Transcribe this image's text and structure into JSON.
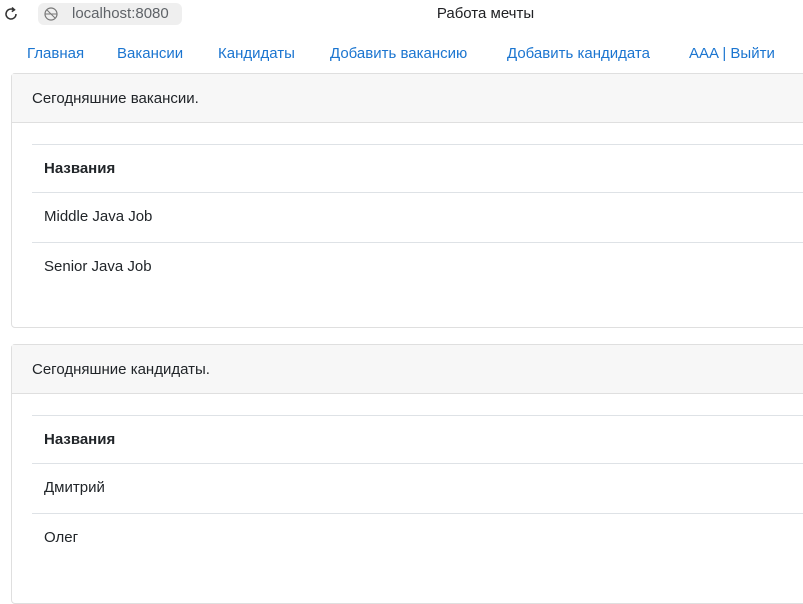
{
  "browser": {
    "address": "localhost:8080",
    "title": "Работа мечты"
  },
  "nav": {
    "items": [
      {
        "label": "Главная"
      },
      {
        "label": "Вакансии"
      },
      {
        "label": "Кандидаты"
      },
      {
        "label": "Добавить вакансию"
      },
      {
        "label": "Добавить кандидата"
      },
      {
        "label": "AAA | Выйти"
      }
    ]
  },
  "vacancies": {
    "header": "Сегодняшние вакансии.",
    "column": "Названия",
    "rows": [
      "Middle Java Job",
      "Senior Java Job"
    ]
  },
  "candidates": {
    "header": "Сегодняшние кандидаты.",
    "column": "Названия",
    "rows": [
      "Дмитрий",
      "Олег"
    ]
  },
  "colors": {
    "link": "#1b75d0",
    "card_header_bg": "#f7f7f7",
    "border": "#dfdfdf"
  }
}
